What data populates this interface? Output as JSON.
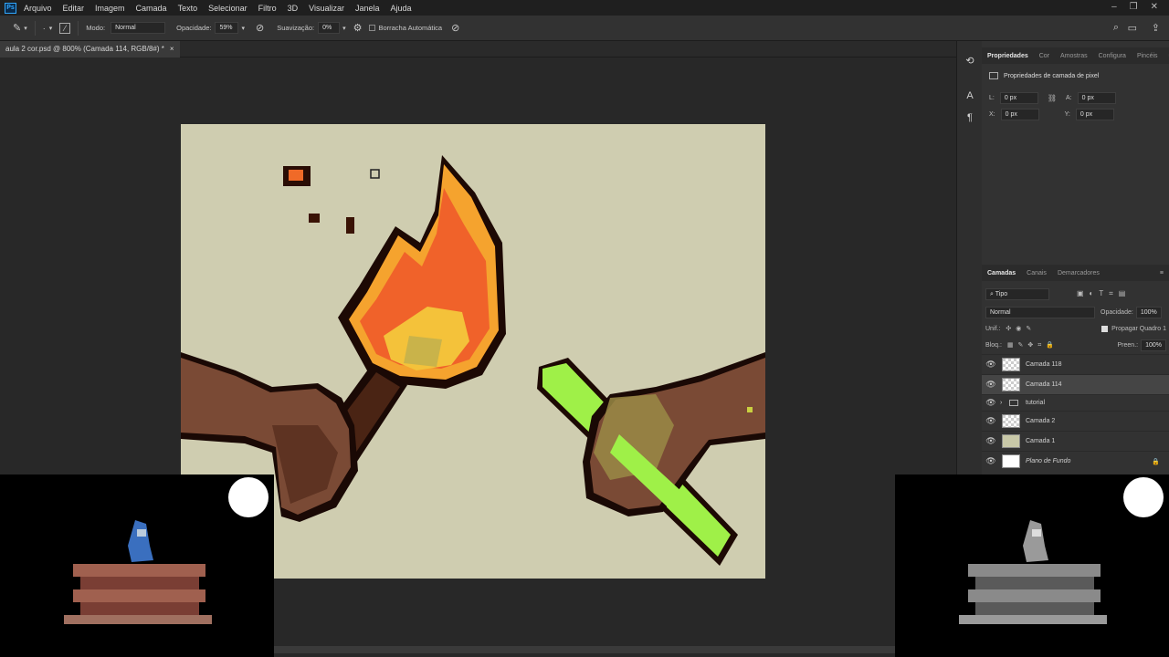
{
  "menubar": {
    "items": [
      "Arquivo",
      "Editar",
      "Imagem",
      "Camada",
      "Texto",
      "Selecionar",
      "Filtro",
      "3D",
      "Visualizar",
      "Janela",
      "Ajuda"
    ]
  },
  "options": {
    "mode_label": "Modo:",
    "mode_value": "Normal",
    "opacity_label": "Opacidade:",
    "opacity_value": "59%",
    "smoothing_label": "Suavização:",
    "smoothing_value": "0%",
    "auto_erase_label": "Borracha Automática"
  },
  "document": {
    "tab_title": "aula 2 cor.psd @ 800% (Camada 114, RGB/8#) *",
    "close": "×"
  },
  "properties_panel": {
    "tabs": [
      "Propriedades",
      "Cor",
      "Amostras",
      "Configura",
      "Pincéis"
    ],
    "title": "Propriedades de camada de pixel",
    "w_label": "L:",
    "w_value": "0 px",
    "h_label": "A:",
    "h_value": "0 px",
    "x_label": "X:",
    "x_value": "0 px",
    "y_label": "Y:",
    "y_value": "0 px"
  },
  "layers_panel": {
    "tabs": [
      "Camadas",
      "Canais",
      "Demarcadores"
    ],
    "filter_value": "Tipo",
    "blend_mode": "Normal",
    "opacity_label": "Opacidade:",
    "opacity_value": "100%",
    "unify_label": "Unif.:",
    "propagate_label": "Propagar Quadro 1",
    "lock_label": "Bloq.:",
    "fill_label": "Preen.:",
    "fill_value": "100%",
    "layers": [
      {
        "name": "Camada 118",
        "selected": false
      },
      {
        "name": "Camada 114",
        "selected": true
      },
      {
        "name": "tutorial",
        "selected": false,
        "group": true
      },
      {
        "name": "Camada 2",
        "selected": false
      },
      {
        "name": "Camada 1",
        "selected": false
      },
      {
        "name": "Plano de Fundo",
        "selected": false,
        "locked": true
      }
    ]
  },
  "colors": {
    "canvas_bg": "#cfcdb0",
    "flame_outer": "#f08a2a",
    "flame_inner": "#f4c23a",
    "skin": "#7a4a35",
    "stick": "#9ff048",
    "brand": "#31a8ff"
  }
}
